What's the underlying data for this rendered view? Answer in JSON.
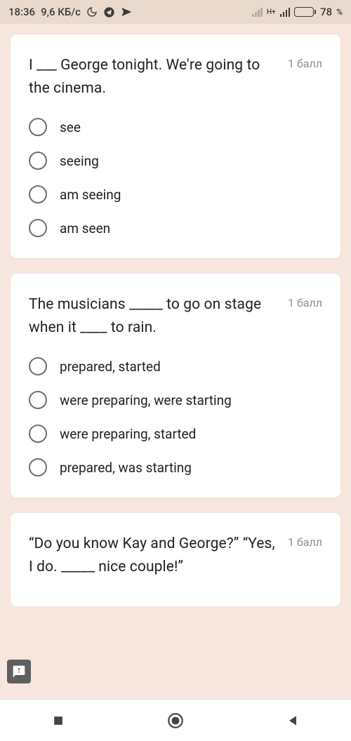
{
  "status": {
    "time": "18:36",
    "speed": "9,6 КБ/с",
    "net_label": "H+",
    "battery_pct": "78",
    "battery_unit": "%"
  },
  "questions": [
    {
      "text": "I ___ George tonight. We're going to the cinema.",
      "points": "1 балл",
      "options": [
        "see",
        "seeing",
        "am seeing",
        "am seen"
      ]
    },
    {
      "text": "The musicians _____ to go on stage when it ____ to rain.",
      "points": "1 балл",
      "options": [
        "prepared, started",
        "were preparing, were starting",
        "were preparing, started",
        "prepared, was starting"
      ]
    },
    {
      "text": "“Do you know Kay and George?” “Yes, I do. _____ nice couple!”",
      "points": "1 балл",
      "options": []
    }
  ]
}
